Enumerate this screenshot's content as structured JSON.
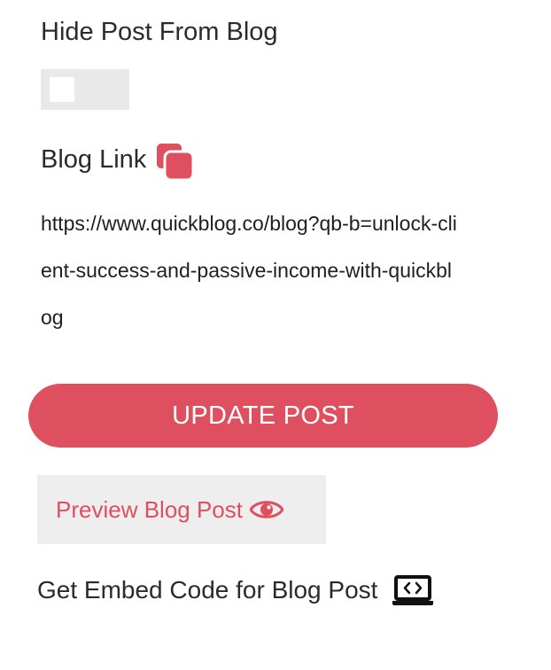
{
  "hide_post": {
    "title": "Hide Post From Blog",
    "toggle_on": false
  },
  "blog_link": {
    "title": "Blog Link",
    "url": "https://www.quickblog.co/blog?qb-b=unlock-client-success-and-passive-income-with-quickblog",
    "copy_icon": "copy-icon"
  },
  "actions": {
    "update_label": "UPDATE POST",
    "preview_label": "Preview Blog Post",
    "preview_icon": "eye-icon",
    "embed_label": "Get Embed Code for Blog Post",
    "embed_icon": "laptop-code-icon"
  },
  "colors": {
    "accent": "#de4f5f",
    "toggle_track": "#e9e9e9",
    "preview_bg": "#eeeeee",
    "text": "#2b2b2b"
  }
}
